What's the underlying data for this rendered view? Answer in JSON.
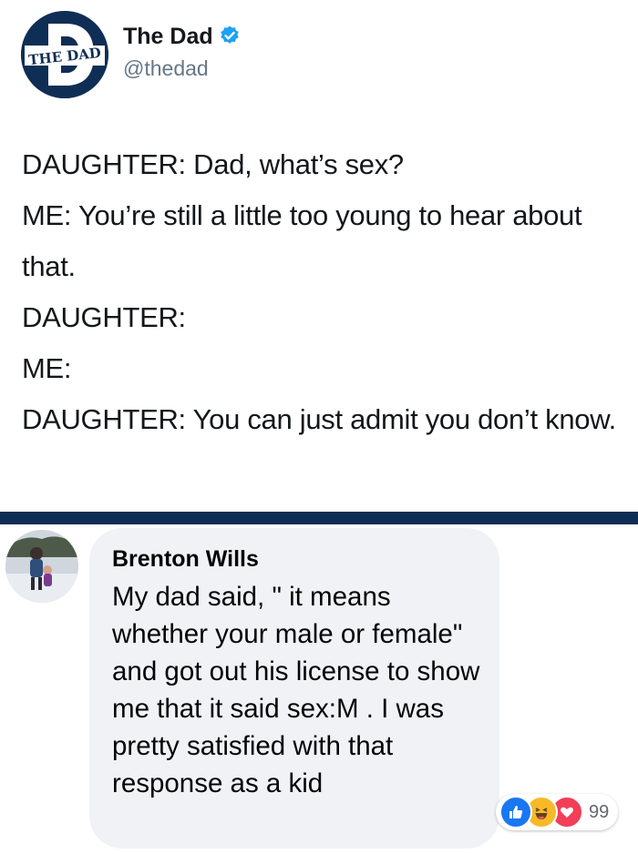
{
  "tweet": {
    "avatar_text": "THE DAD",
    "display_name": "The Dad",
    "handle": "@thedad",
    "lines": [
      "DAUGHTER: Dad, what’s sex?",
      "ME: You’re still a little too young to hear about that.",
      "DAUGHTER:",
      "ME:",
      "DAUGHTER: You can just admit you don’t know."
    ]
  },
  "comment": {
    "author": "Brenton Wills",
    "text": "My dad said, \" it means whether your male or female\" and got out his license to show me that it said sex:M . I was pretty satisfied with that response as a kid",
    "reactions": [
      "like-icon",
      "haha-icon",
      "love-icon"
    ],
    "reaction_count": "99"
  },
  "colors": {
    "brand_navy": "#0f2e55",
    "verified_blue": "#1da1f2",
    "bubble_bg": "#f0f2f5",
    "like_blue": "#1877f2",
    "love_red": "#f33e58",
    "haha_yellow": "#f7b928"
  }
}
